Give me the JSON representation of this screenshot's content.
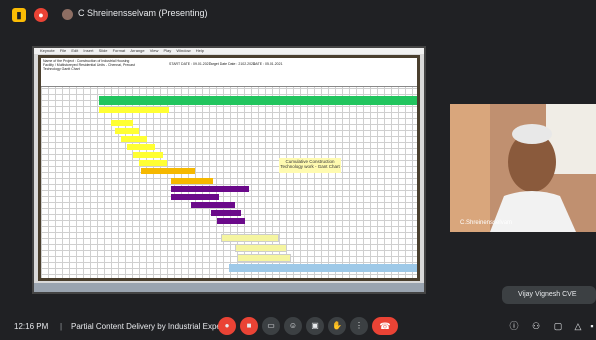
{
  "header": {
    "presenter": "C Shreinensselvam (Presenting)"
  },
  "screenshare": {
    "menu_items": [
      "Keynote",
      "File",
      "Edit",
      "Insert",
      "Slide",
      "Format",
      "Arrange",
      "View",
      "Play",
      "Window",
      "Help"
    ],
    "sheet": {
      "title_text": "Name of the Project : Construction of Industrial Housing Facility / Multistoreyed Residential Units - Chennai, Precast Technology Gantt Chart",
      "schedule_label": "START DATE : 09.01.2021",
      "finish_label": "Target Date Date : 2102.2023",
      "duration_label": "DATE : 05.01.2021",
      "note": "Cumulative Construction Technology work - Gant Chart"
    }
  },
  "participants": {
    "remote_name": "C.Shreinensselvam",
    "self_name": "Vijay Vignesh CVE"
  },
  "bottom": {
    "time": "12:16 PM",
    "separator": "|",
    "meeting_title": "Partial Content Delivery by Industrial Expert:..."
  },
  "icons": {
    "mic": "microphone-off-icon",
    "cam": "camera-off-icon",
    "cc": "captions-icon",
    "emoji": "emoji-icon",
    "present": "present-icon",
    "hand": "raise-hand-icon",
    "more": "more-icon",
    "end": "end-call-icon",
    "info": "info-icon",
    "people": "people-icon",
    "chat": "chat-icon",
    "activities": "activities-icon",
    "lock": "lock-icon"
  },
  "colors": {
    "accent_red": "#ea4335",
    "gantt_green": "#22c55e",
    "gantt_yellow": "#ffff33",
    "gantt_purple": "#6b0a8a",
    "gantt_gold": "#f5b800",
    "gantt_lightblue": "#9ec9e8"
  }
}
